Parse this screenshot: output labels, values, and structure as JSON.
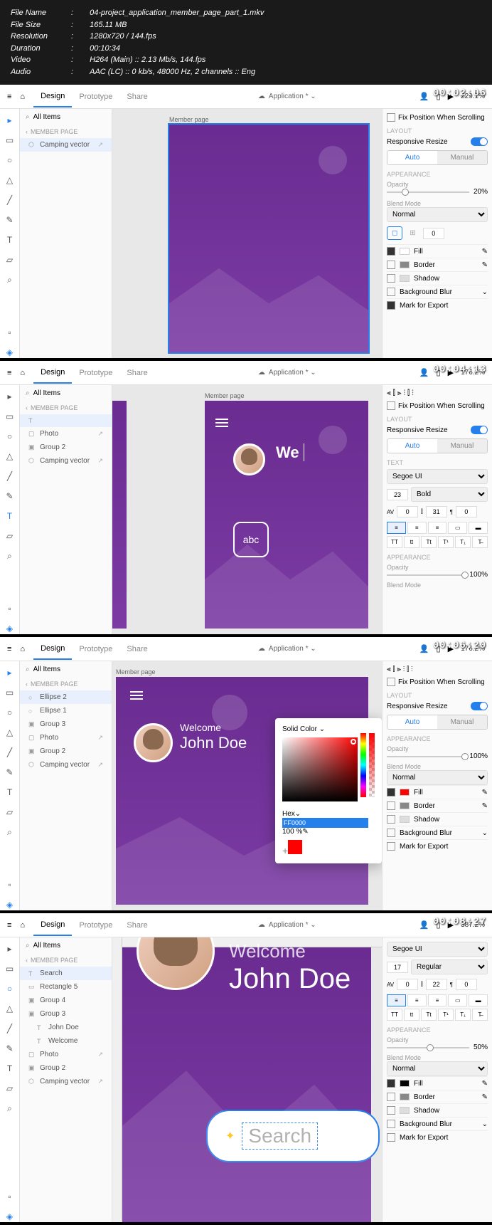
{
  "meta": {
    "file_name_label": "File Name",
    "file_name": "04-project_application_member_page_part_1.mkv",
    "file_size_label": "File Size",
    "file_size": "165.11 MB",
    "resolution_label": "Resolution",
    "resolution": "1280x720 / 144.fps",
    "duration_label": "Duration",
    "duration": "00:10:34",
    "video_label": "Video",
    "video": "H264 (Main) :: 2.13 Mb/s, 144.fps",
    "audio_label": "Audio",
    "audio": "AAC (LC) :: 0 kb/s, 48000 Hz, 2 channels :: Eng"
  },
  "tabs": {
    "design": "Design",
    "prototype": "Prototype",
    "share": "Share"
  },
  "center": {
    "application": "Application *"
  },
  "search_layers": "All Items",
  "artboard_name": "Member page",
  "section_member": "MEMBER PAGE",
  "frame1": {
    "timestamp": "00:02:06",
    "zoom": "229.1%",
    "layers": {
      "camping": "Camping vector"
    },
    "props": {
      "fix_scroll": "Fix Position When Scrolling",
      "layout": "LAYOUT",
      "responsive": "Responsive Resize",
      "auto": "Auto",
      "manual": "Manual",
      "appearance": "APPEARANCE",
      "opacity": "Opacity",
      "opacity_val": "20%",
      "blend": "Blend Mode",
      "normal": "Normal",
      "fill": "Fill",
      "border": "Border",
      "shadow": "Shadow",
      "bgblur": "Background Blur",
      "mark_export": "Mark for Export"
    }
  },
  "frame2": {
    "timestamp": "00:04:13",
    "zoom": "176.2%",
    "layers": {
      "t": "T",
      "photo": "Photo",
      "group2": "Group 2",
      "camping": "Camping vector"
    },
    "welcome_partial": "We",
    "abc": "abc",
    "props": {
      "fix_scroll": "Fix Position When Scrolling",
      "layout": "LAYOUT",
      "responsive": "Responsive Resize",
      "auto": "Auto",
      "manual": "Manual",
      "text": "TEXT",
      "font": "Segoe UI",
      "size": "23",
      "weight": "Bold",
      "char_spacing": "0",
      "line_spacing": "31",
      "para_spacing": "0",
      "appearance": "APPEARANCE",
      "opacity": "Opacity",
      "opacity_val": "100%",
      "blend": "Blend Mode"
    }
  },
  "frame3": {
    "timestamp": "00:06:20",
    "zoom": "176.2%",
    "layers": {
      "ellipse2": "Ellipse 2",
      "ellipse1": "Ellipse 1",
      "group3": "Group 3",
      "photo": "Photo",
      "group2": "Group 2",
      "camping": "Camping vector"
    },
    "welcome": "Welcome",
    "john": "John Doe",
    "colorpicker": {
      "solid": "Solid Color",
      "hex_label": "Hex",
      "hex": "FF0000",
      "alpha": "100 %"
    },
    "props": {
      "fix_scroll": "Fix Position When Scrolling",
      "layout": "LAYOUT",
      "responsive": "Responsive Resize",
      "auto": "Auto",
      "manual": "Manual",
      "appearance": "APPEARANCE",
      "opacity": "Opacity",
      "opacity_val": "100%",
      "blend": "Blend Mode",
      "normal": "Normal",
      "fill": "Fill",
      "border": "Border",
      "shadow": "Shadow",
      "bgblur": "Background Blur",
      "mark_export": "Mark for Export"
    }
  },
  "frame4": {
    "timestamp": "00:08:27",
    "zoom": "387.2%",
    "layers": {
      "search": "Search",
      "rectangle5": "Rectangle 5",
      "group4": "Group 4",
      "group3": "Group 3",
      "johndoe": "John Doe",
      "welcome": "Welcome",
      "photo": "Photo",
      "group2": "Group 2",
      "camping": "Camping vector"
    },
    "welcome": "Welcome",
    "john": "John Doe",
    "search_text": "Search",
    "props": {
      "font": "Segoe UI",
      "size": "17",
      "weight": "Regular",
      "char_spacing": "0",
      "line_spacing": "22",
      "para_spacing": "0",
      "appearance": "APPEARANCE",
      "opacity": "Opacity",
      "opacity_val": "50%",
      "blend": "Blend Mode",
      "normal": "Normal",
      "fill": "Fill",
      "border": "Border",
      "shadow": "Shadow",
      "bgblur": "Background Blur",
      "mark_export": "Mark for Export"
    }
  }
}
